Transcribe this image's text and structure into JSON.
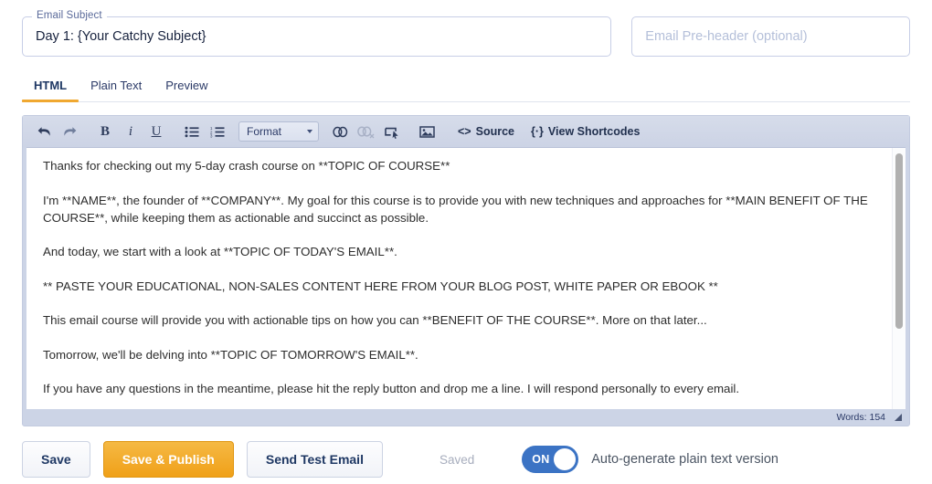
{
  "colors": {
    "accent_orange": "#f0a830",
    "navy_text": "#1f3864",
    "toggle_blue": "#3b73c4",
    "field_border": "#c7cee6",
    "toolbar_bg": "#ccd4e6"
  },
  "subject_field": {
    "legend": "Email Subject",
    "value": "Day 1: {Your Catchy Subject}",
    "placeholder": ""
  },
  "preheader_field": {
    "value": "",
    "placeholder": "Email Pre-header (optional)"
  },
  "tabs": [
    {
      "label": "HTML",
      "active": true
    },
    {
      "label": "Plain Text",
      "active": false
    },
    {
      "label": "Preview",
      "active": false
    }
  ],
  "toolbar": {
    "undo_title": "Undo",
    "redo_title": "Redo",
    "bold_label": "B",
    "italic_label": "i",
    "underline_label": "U",
    "bullet_list_title": "Bulleted list",
    "numbered_list_title": "Numbered list",
    "format_label": "Format",
    "link_title": "Insert/edit link",
    "unlink_title": "Remove link",
    "anchor_title": "Insert anchor",
    "image_title": "Insert image",
    "source_label": "Source",
    "source_icon_label": "<>",
    "shortcodes_label": "View Shortcodes",
    "shortcodes_icon_label": "{·}"
  },
  "editor_body": {
    "paragraphs": [
      "Thanks for checking out my 5-day crash course on **TOPIC OF COURSE**",
      "I'm **NAME**, the founder of **COMPANY**. My goal for this course is to provide you with new techniques and approaches for **MAIN BENEFIT OF THE COURSE**, while keeping them as actionable and succinct as possible.",
      "And today, we start with a look at **TOPIC OF TODAY'S EMAIL**.",
      "** PASTE YOUR EDUCATIONAL, NON-SALES CONTENT HERE FROM YOUR BLOG POST, WHITE PAPER OR EBOOK **",
      "This email course will provide you with actionable tips on how you can **BENEFIT OF THE COURSE**. More on that later...",
      "Tomorrow, we'll be delving into **TOPIC OF TOMORROW'S EMAIL**.",
      "If you have any questions in the meantime, please hit the reply button and drop me a line. I will respond personally to every email."
    ]
  },
  "status_bar": {
    "word_count": "Words: 154"
  },
  "actions": {
    "save_label": "Save",
    "save_publish_label": "Save & Publish",
    "send_test_label": "Send Test Email",
    "saved_note": "Saved",
    "toggle_state": "ON",
    "toggle_label": "Auto-generate plain text version"
  }
}
